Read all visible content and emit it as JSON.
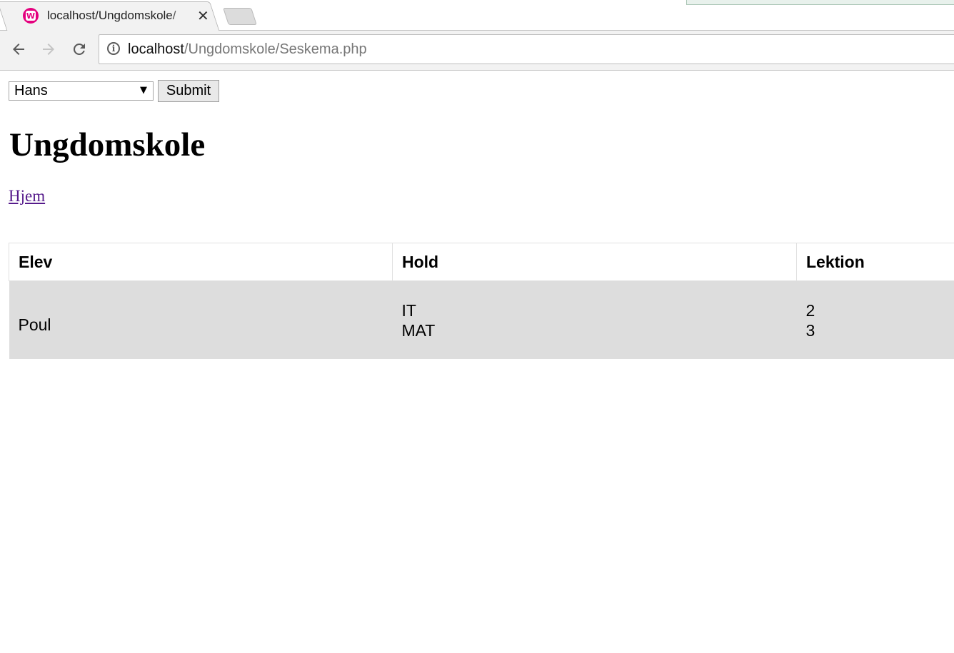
{
  "browser": {
    "tab": {
      "title": "localhost/Ungdomskole/",
      "favicon_letter": "W",
      "favicon_color": "#e4007e",
      "close_glyph": "✕"
    },
    "address": {
      "host": "localhost",
      "path": "/Ungdomskole/Seskema.php"
    },
    "icons": [
      "back-arrow-icon",
      "forward-arrow-icon",
      "reload-icon",
      "info-icon"
    ]
  },
  "form": {
    "select_value": "Hans",
    "submit_label": "Submit"
  },
  "page": {
    "title": "Ungdomskole",
    "home_link": "Hjem",
    "link_color": "#551a8b"
  },
  "table": {
    "headers": [
      "Elev",
      "Hold",
      "Lektion"
    ],
    "rows": [
      {
        "elev": "Poul",
        "hold": [
          "IT",
          "MAT"
        ],
        "lektion": [
          "2",
          "3"
        ]
      }
    ],
    "row_color": "#dddddd"
  }
}
